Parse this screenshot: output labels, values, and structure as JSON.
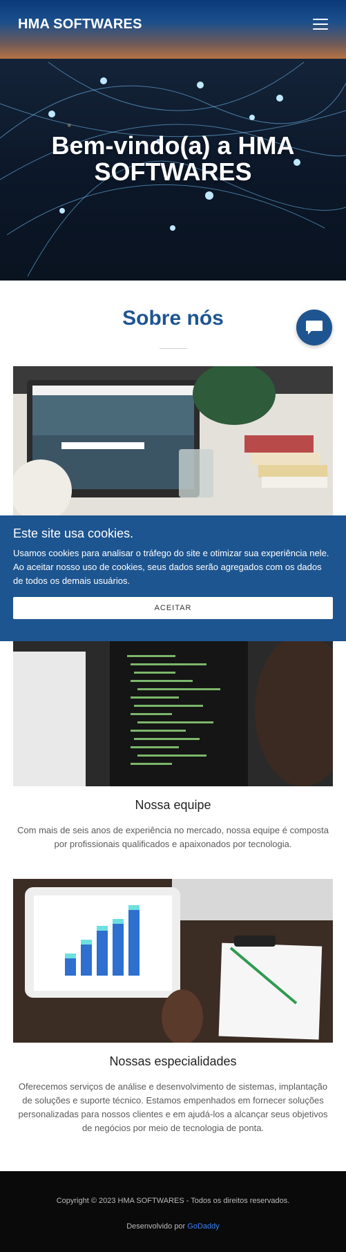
{
  "header": {
    "brand": "HMA SOFTWARES",
    "menu_icon": "hamburger-icon"
  },
  "hero": {
    "title_line1": "Bem-vindo(a) a HMA",
    "title_line2": "SOFTWARES"
  },
  "about": {
    "title": "Sobre nós"
  },
  "chat": {
    "icon": "chat-bubble-icon"
  },
  "cookie_banner": {
    "title": "Este site usa cookies.",
    "text": "Usamos cookies para analisar o tráfego do site e otimizar sua experiência nele. Ao aceitar nosso uso de cookies, seus dados serão agregados com os dados de todos os demais usuários.",
    "accept_label": "ACEITAR"
  },
  "cards": [
    {
      "title": "",
      "text": ""
    },
    {
      "title": "Nossa equipe",
      "text": "Com mais de seis anos de experiência no mercado, nossa equipe é composta por profissionais qualificados e apaixonados por tecnologia."
    },
    {
      "title": "Nossas especialidades",
      "text": "Oferecemos serviços de análise e desenvolvimento de sistemas, implantação de soluções e suporte técnico. Estamos empenhados em fornecer soluções personalizadas para nossos clientes e em ajudá-los a alcançar seus objetivos de negócios por meio de tecnologia de ponta."
    }
  ],
  "footer": {
    "copyright": "Copyright © 2023 HMA SOFTWARES - Todos os direitos reservados.",
    "developed_by": "Desenvolvido por",
    "developer_link": "GoDaddy"
  },
  "colors": {
    "brand_blue": "#1e5591",
    "cookie_bg": "#1d5590",
    "footer_bg": "#0a0a0a"
  }
}
